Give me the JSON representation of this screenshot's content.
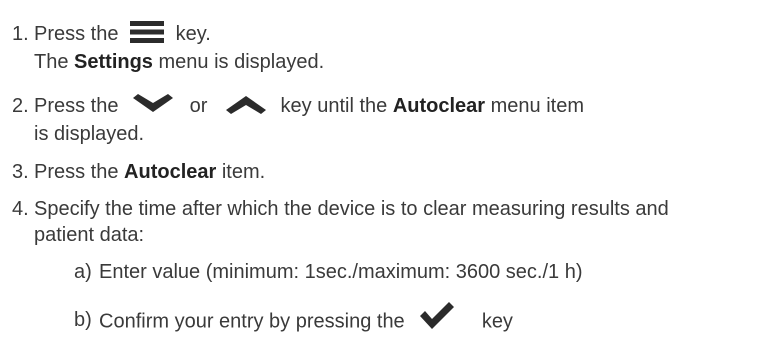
{
  "steps": [
    {
      "number": "1.",
      "line1_before": "Press the",
      "icon": "menu-icon",
      "line1_after": "key.",
      "line2_before": "The",
      "line2_bold": "Settings",
      "line2_after": "menu is displayed."
    },
    {
      "number": "2.",
      "line1_before": "Press the",
      "icon_a": "chevron-down-icon",
      "line1_or": "or",
      "icon_b": "chevron-up-icon",
      "line1_mid": "key until the",
      "line1_bold": "Autoclear",
      "line1_after": "menu item",
      "line2": "is displayed."
    },
    {
      "number": "3.",
      "before": "Press the",
      "bold": "Autoclear",
      "after": "item."
    },
    {
      "number": "4.",
      "line1": "Specify the time after which the device is to clear measuring results and",
      "line2": "patient data:"
    }
  ],
  "substeps": [
    {
      "label": "a)",
      "text": "Enter value (minimum: 1sec./maximum: 3600 sec./1 h)"
    },
    {
      "label": "b)",
      "before": "Confirm your entry by pressing the",
      "icon": "checkmark-icon",
      "after": "key"
    }
  ],
  "colors": {
    "text": "#3a3a3a",
    "icon": "#2b2b2b"
  }
}
